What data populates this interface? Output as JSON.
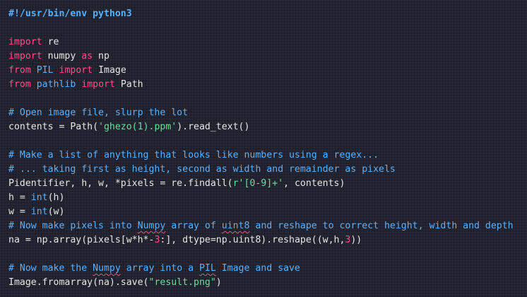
{
  "editor": {
    "lines": [
      [
        {
          "t": "#!/usr/bin/env python3",
          "c": "shebang"
        }
      ],
      [],
      [
        {
          "t": "import",
          "c": "kw"
        },
        {
          "t": " re"
        }
      ],
      [
        {
          "t": "import",
          "c": "kw"
        },
        {
          "t": " numpy "
        },
        {
          "t": "as",
          "c": "kw"
        },
        {
          "t": " np"
        }
      ],
      [
        {
          "t": "from",
          "c": "kw"
        },
        {
          "t": " "
        },
        {
          "t": "PIL",
          "c": "bi"
        },
        {
          "t": " "
        },
        {
          "t": "import",
          "c": "kw"
        },
        {
          "t": " Image"
        }
      ],
      [
        {
          "t": "from",
          "c": "kw"
        },
        {
          "t": " "
        },
        {
          "t": "pathlib",
          "c": "bi"
        },
        {
          "t": " "
        },
        {
          "t": "import",
          "c": "kw"
        },
        {
          "t": " Path"
        }
      ],
      [],
      [
        {
          "t": "# Open image file, slurp the lot",
          "c": "cm"
        }
      ],
      [
        {
          "t": "contents = Path("
        },
        {
          "t": "'ghezo(1).ppm'",
          "c": "str"
        },
        {
          "t": ").read_text()"
        }
      ],
      [],
      [
        {
          "t": "# Make a list of anything that looks like numbers using a regex...",
          "c": "cm"
        }
      ],
      [
        {
          "t": "# ... taking first as height, second as width and remainder as pixels",
          "c": "cm"
        }
      ],
      [
        {
          "t": "Pidentifier, h, w, *pixels = re.findall("
        },
        {
          "t": "r'[0-9]+'",
          "c": "str"
        },
        {
          "t": ", contents)"
        }
      ],
      [
        {
          "t": "h = "
        },
        {
          "t": "int",
          "c": "bi"
        },
        {
          "t": "(h)"
        }
      ],
      [
        {
          "t": "w = "
        },
        {
          "t": "int",
          "c": "bi"
        },
        {
          "t": "(w)"
        }
      ],
      [
        {
          "t": "# Now make pixels into ",
          "c": "cm"
        },
        {
          "t": "Numpy",
          "c": "cm sq"
        },
        {
          "t": " array of ",
          "c": "cm"
        },
        {
          "t": "uint8",
          "c": "cm sq"
        },
        {
          "t": " and reshape to correct height, width and depth",
          "c": "cm"
        }
      ],
      [
        {
          "t": "na = np.array(pixels[w*h*-"
        },
        {
          "t": "3",
          "c": "num"
        },
        {
          "t": ":], dtype=np.uint8).reshape((w,h,"
        },
        {
          "t": "3",
          "c": "num"
        },
        {
          "t": "))"
        }
      ],
      [],
      [
        {
          "t": "# Now make the ",
          "c": "cm"
        },
        {
          "t": "Numpy",
          "c": "cm sq"
        },
        {
          "t": " array into a ",
          "c": "cm"
        },
        {
          "t": "PIL",
          "c": "cm sq"
        },
        {
          "t": " Image and save",
          "c": "cm"
        }
      ],
      [
        {
          "t": "Image.fromarray(na).save("
        },
        {
          "t": "\"result.png\"",
          "c": "str"
        },
        {
          "t": ")"
        }
      ]
    ]
  }
}
